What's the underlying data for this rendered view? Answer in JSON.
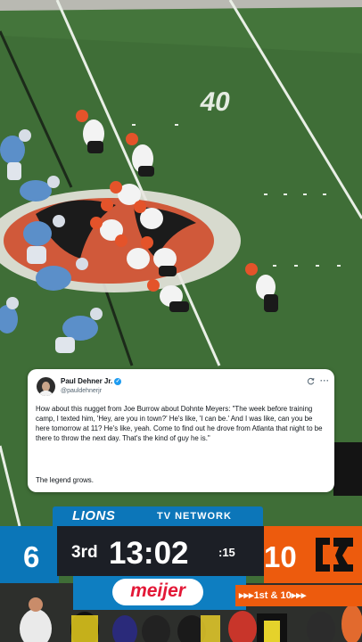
{
  "tweet": {
    "name": "Paul Dehner Jr.",
    "handle": "@pauldehnerjr",
    "body": "How about this nugget from Joe Burrow about Dohnte Meyers: \"The week before training camp, I texted him, 'Hey, are you in town?' He's like, 'I can be.' And I was like, can you be here tomorrow at 11? He's like, yeah. Come to find out he drove from Atlanta that night to be there to throw the next day. That's the kind of guy he is.\"",
    "footer": "The legend grows.",
    "verified_icon": "verified-badge-icon",
    "refresh_icon": "refresh-icon",
    "more_label": "···"
  },
  "broadcast": {
    "network_logo": "LIONS",
    "network_label": "TV NETWORK",
    "home_score": "6",
    "quarter": "3rd",
    "game_clock": "13:02",
    "play_clock": ":15",
    "away_score": "10",
    "sponsor": "meijer",
    "down_distance": "▸▸▸1st & 10▸▸▸"
  },
  "field": {
    "yard_marker": "40"
  },
  "colors": {
    "lions_blue": "#0b76b8",
    "bengals_orange": "#ed5b0d",
    "turf": "#3c6b35",
    "sponsor_red": "#e31837"
  }
}
